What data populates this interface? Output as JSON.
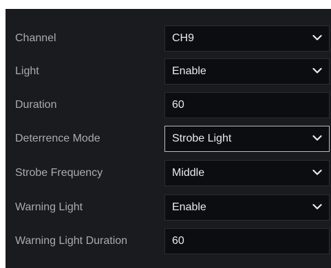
{
  "form": {
    "rows": [
      {
        "label": "Channel",
        "value": "CH9",
        "type": "select",
        "icon": "chevron-down-icon"
      },
      {
        "label": "Light",
        "value": "Enable",
        "type": "select",
        "icon": "chevron-down-icon"
      },
      {
        "label": "Duration",
        "value": "60",
        "type": "input"
      },
      {
        "label": "Deterrence Mode",
        "value": "Strobe Light",
        "type": "select",
        "focused": true,
        "icon": "chevron-down-icon"
      },
      {
        "label": "Strobe Frequency",
        "value": "Middle",
        "type": "select",
        "icon": "chevron-down-icon"
      },
      {
        "label": "Warning Light",
        "value": "Enable",
        "type": "select",
        "icon": "chevron-down-icon"
      },
      {
        "label": "Warning Light Duration",
        "value": "60",
        "type": "input"
      }
    ]
  },
  "colors": {
    "panel_background": "#1a1b1f",
    "control_background": "#0c0d10",
    "label_text": "#a8abb1",
    "value_text": "#e9eaec",
    "focus_border": "#b9bcc2"
  }
}
